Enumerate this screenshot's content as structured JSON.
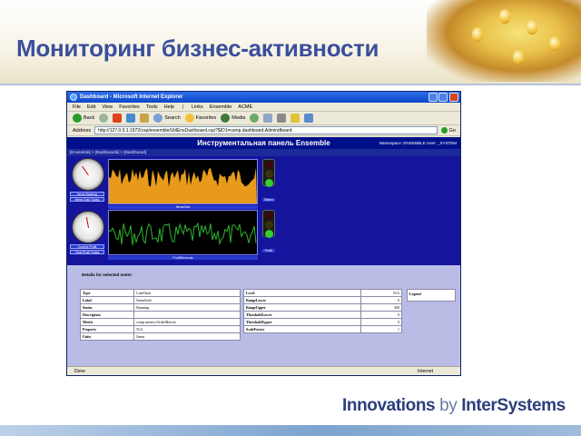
{
  "slide": {
    "title": "Мониторинг бизнес-активности",
    "brand_innovations": "Innovations",
    "brand_by": " by ",
    "brand_company": "InterSystems"
  },
  "browser": {
    "window_title": "Dashboard - Microsoft Internet Explorer",
    "menu": [
      "File",
      "Edit",
      "View",
      "Favorites",
      "Tools",
      "Help"
    ],
    "links": [
      "Links",
      "Ensemble",
      "ACME"
    ],
    "toolbar": {
      "back": "Back",
      "search": "Search",
      "favorites": "Favorites",
      "media": "Media"
    },
    "address_label": "Address",
    "address_value": "http://127.0.0.1:1972/csp/ensemble/UtilEnsDashboard.csp?$ID1=csmp.dashboard.Admindboard",
    "go_label": "Go",
    "status_left": "Done",
    "status_zone": "Internet"
  },
  "ensemble": {
    "header_title": "Инструментальная панель Ensemble",
    "namespace": "Namespace: ENSEMBLE  User: _SYSTEM",
    "breadcrumb": "[Ensemble] > [Dashboards] > [Dashboard]",
    "meters": [
      {
        "gauge_label_1": "Items Backlog",
        "gauge_label_2": "Items Sold Today",
        "chart_label": "ItemsSold",
        "light_label": "Status"
      },
      {
        "gauge_label_1": "Current Profit",
        "gauge_label_2": "Total Profit Today",
        "chart_label": "ProfitRevenue",
        "light_label": "Profit"
      }
    ],
    "details_title": "Details for selected meter:",
    "legend_title": "Legend",
    "table_left": [
      [
        "Type",
        "LineChart"
      ],
      [
        "Label",
        "ItemsSold"
      ],
      [
        "Status",
        "Running"
      ],
      [
        "Description",
        ""
      ],
      [
        "Metric",
        "csmp.metrics.OrderMetrics"
      ],
      [
        "Property",
        "N/A"
      ],
      [
        "Units",
        "Items"
      ]
    ],
    "table_right": [
      [
        "Level",
        "N/A"
      ],
      [
        "RangeLower",
        "0"
      ],
      [
        "RangeUpper",
        "300"
      ],
      [
        "ThresholdLower",
        "0"
      ],
      [
        "ThresholdUpper",
        "0"
      ],
      [
        "ScaleFactor",
        "1"
      ]
    ]
  },
  "colors": {
    "title_blue": "#3a4f9c",
    "ensemble_blue": "#14149c",
    "chart_orange": "#e89a1a",
    "chart_green": "#2fb52f"
  }
}
